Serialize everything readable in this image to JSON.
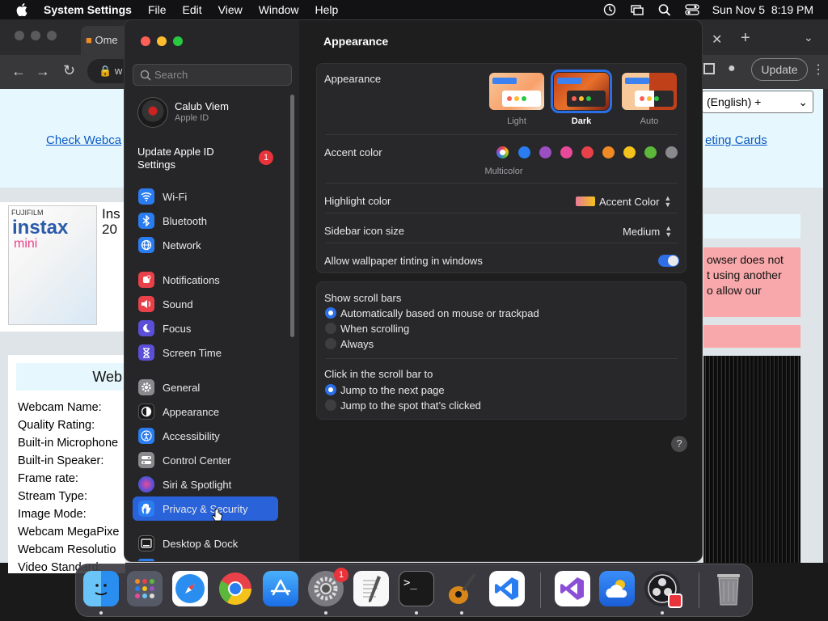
{
  "menubar": {
    "app_name": "System Settings",
    "menus": [
      "File",
      "Edit",
      "View",
      "Window",
      "Help"
    ],
    "datetime": "Sun Nov 5  8:19 PM"
  },
  "browser": {
    "tab_title": "Ome",
    "address_partial": "w",
    "update_button": "Update",
    "language_select": "(English) +",
    "link_left": "Check Webca",
    "link_right": "eting Cards",
    "product_title": "Ins",
    "product_sub": "20",
    "warning_lines": [
      "owser does not",
      "t using another",
      "o allow our"
    ],
    "panel_title": "Web",
    "panel_rows": [
      "Webcam Name:",
      "Quality Rating:",
      "Built-in Microphone",
      "Built-in Speaker:",
      "Frame rate:",
      "Stream Type:",
      "Image Mode:",
      "Webcam MegaPixe",
      "Webcam Resolutio",
      "Video Standard:"
    ]
  },
  "sidebar": {
    "search_placeholder": "Search",
    "user_name": "Calub Viem",
    "user_sub": "Apple ID",
    "update_apple_id": "Update Apple ID Settings",
    "update_badge": "1",
    "items": [
      {
        "label": "Wi-Fi",
        "icon": "wifi-icon",
        "color": "#2a7df0"
      },
      {
        "label": "Bluetooth",
        "icon": "bluetooth-icon",
        "color": "#2a7df0"
      },
      {
        "label": "Network",
        "icon": "globe-icon",
        "color": "#2a7df0"
      },
      {
        "label": "Notifications",
        "icon": "bell-icon",
        "color": "#e8414a"
      },
      {
        "label": "Sound",
        "icon": "speaker-icon",
        "color": "#e8414a"
      },
      {
        "label": "Focus",
        "icon": "moon-icon",
        "color": "#5a4fd6"
      },
      {
        "label": "Screen Time",
        "icon": "hourglass-icon",
        "color": "#5a4fd6"
      },
      {
        "label": "General",
        "icon": "gear-icon",
        "color": "#8a8a8e"
      },
      {
        "label": "Appearance",
        "icon": "appearance-icon",
        "color": "#1a1a1a"
      },
      {
        "label": "Accessibility",
        "icon": "accessibility-icon",
        "color": "#2a7df0"
      },
      {
        "label": "Control Center",
        "icon": "control-center-icon",
        "color": "#8a8a8e"
      },
      {
        "label": "Siri & Spotlight",
        "icon": "siri-icon",
        "color": "#b03ad0"
      },
      {
        "label": "Privacy & Security",
        "icon": "hand-icon",
        "color": "#2a7df0"
      },
      {
        "label": "Desktop & Dock",
        "icon": "desktop-icon",
        "color": "#1a1a1a"
      }
    ]
  },
  "content": {
    "title": "Appearance",
    "appearance_label": "Appearance",
    "appearance_options": [
      "Light",
      "Dark",
      "Auto"
    ],
    "accent_label": "Accent color",
    "accent_multicolor": "Multicolor",
    "accent_colors": [
      "#2a7df0",
      "#9b4fc2",
      "#e84a9a",
      "#e8414a",
      "#f08a24",
      "#f3c21b",
      "#5cb83a",
      "#8a8a8e"
    ],
    "highlight_label": "Highlight color",
    "highlight_value": "Accent Color",
    "sidebar_icon_label": "Sidebar icon size",
    "sidebar_icon_value": "Medium",
    "wallpaper_tint_label": "Allow wallpaper tinting in windows",
    "scroll_bars_label": "Show scroll bars",
    "scroll_options": [
      "Automatically based on mouse or trackpad",
      "When scrolling",
      "Always"
    ],
    "click_label": "Click in the scroll bar to",
    "click_options": [
      "Jump to the next page",
      "Jump to the spot that’s clicked"
    ],
    "help": "?"
  },
  "dock": {
    "settings_badge": "1"
  }
}
